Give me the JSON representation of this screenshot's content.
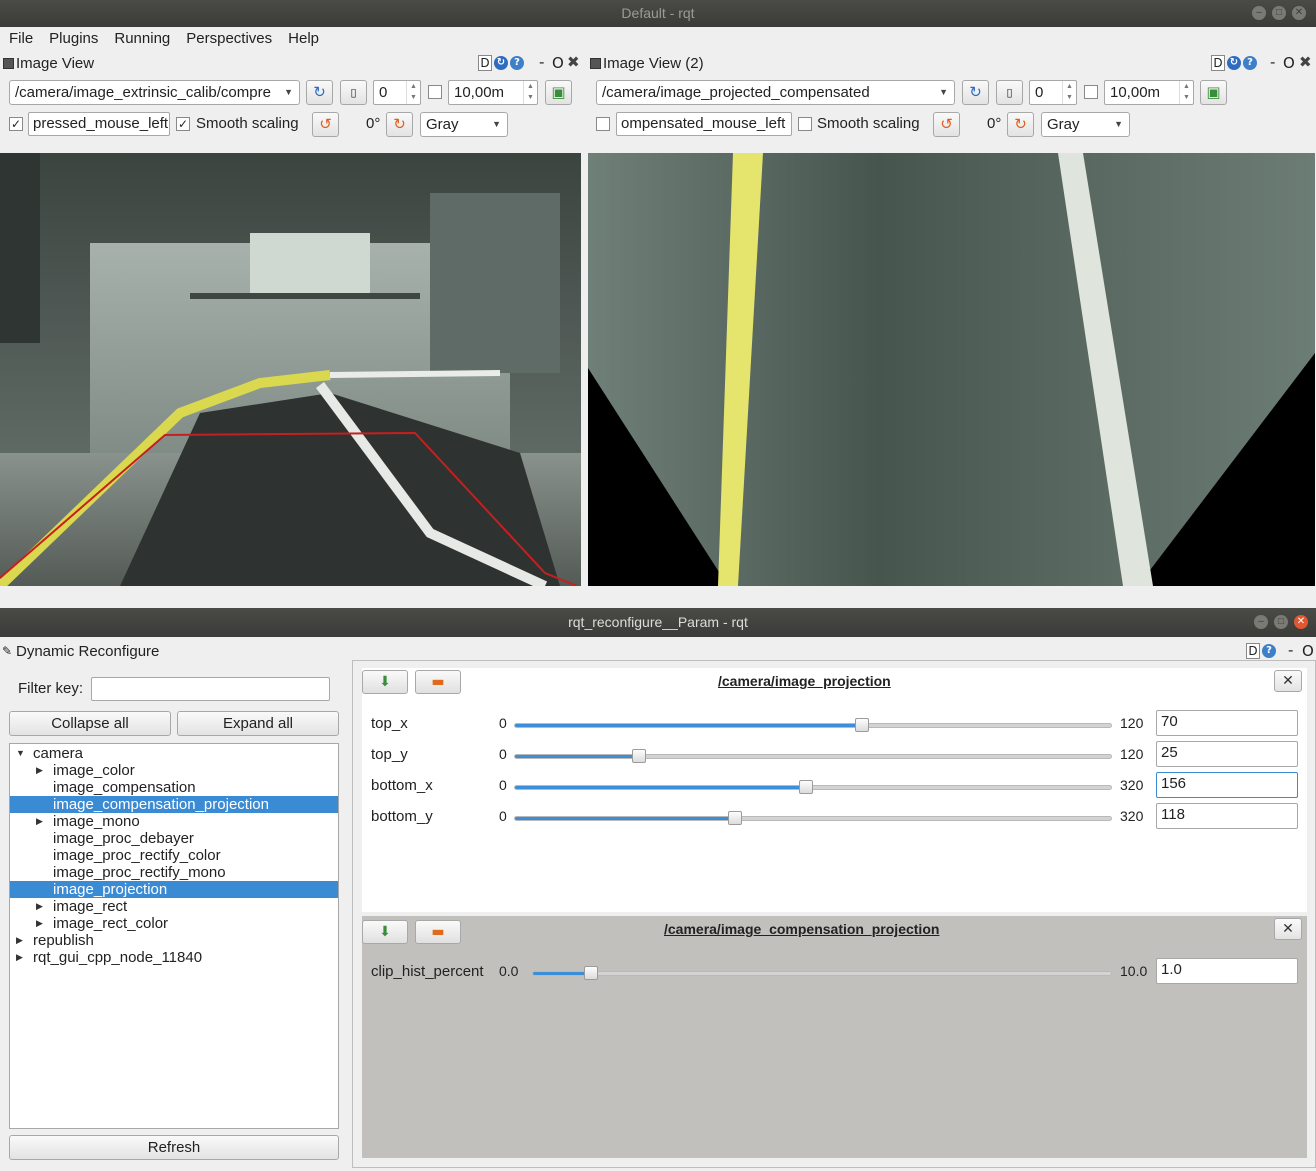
{
  "window_main": {
    "title": "Default - rqt"
  },
  "menu": [
    "File",
    "Plugins",
    "Running",
    "Perspectives",
    "Help"
  ],
  "image_view_1": {
    "title": "Image View",
    "topic": "/camera/image_extrinsic_calib/compre",
    "rotation_value": "0",
    "max_value": "10,00m",
    "mouse_topic": "pressed_mouse_left",
    "mouse_checked": true,
    "smooth_label": "Smooth scaling",
    "smooth_checked": true,
    "angle": "0°",
    "color_scheme": "Gray"
  },
  "image_view_2": {
    "title": "Image View (2)",
    "topic": "/camera/image_projected_compensated",
    "rotation_value": "0",
    "max_value": "10,00m",
    "mouse_topic": "ompensated_mouse_left",
    "mouse_checked": false,
    "smooth_label": "Smooth scaling",
    "smooth_checked": false,
    "angle": "0°",
    "color_scheme": "Gray"
  },
  "header_buttons": {
    "d": "D",
    "o": "O",
    "dash": "-"
  },
  "window_reconf": {
    "title": "rqt_reconfigure__Param - rqt"
  },
  "reconf": {
    "plugin_title": "Dynamic Reconfigure",
    "filter_label": "Filter key:",
    "filter_value": "",
    "collapse_label": "Collapse all",
    "expand_label": "Expand all",
    "refresh_label": "Refresh",
    "tree": [
      {
        "label": "camera",
        "depth": 0,
        "arrow": "down",
        "selected": false
      },
      {
        "label": "image_color",
        "depth": 1,
        "arrow": "right",
        "selected": false
      },
      {
        "label": "image_compensation",
        "depth": 1,
        "arrow": "",
        "selected": false
      },
      {
        "label": "image_compensation_projection",
        "depth": 1,
        "arrow": "",
        "selected": true
      },
      {
        "label": "image_mono",
        "depth": 1,
        "arrow": "right",
        "selected": false
      },
      {
        "label": "image_proc_debayer",
        "depth": 1,
        "arrow": "",
        "selected": false
      },
      {
        "label": "image_proc_rectify_color",
        "depth": 1,
        "arrow": "",
        "selected": false
      },
      {
        "label": "image_proc_rectify_mono",
        "depth": 1,
        "arrow": "",
        "selected": false
      },
      {
        "label": "image_projection",
        "depth": 1,
        "arrow": "",
        "selected": true
      },
      {
        "label": "image_rect",
        "depth": 1,
        "arrow": "right",
        "selected": false
      },
      {
        "label": "image_rect_color",
        "depth": 1,
        "arrow": "right",
        "selected": false
      },
      {
        "label": "republish",
        "depth": 0,
        "arrow": "right",
        "selected": false
      },
      {
        "label": "rqt_gui_cpp_node_11840",
        "depth": 0,
        "arrow": "right",
        "selected": false
      }
    ],
    "panel1": {
      "title": "/camera/image_projection",
      "params": [
        {
          "name": "top_x",
          "min": "0",
          "max": "120",
          "value": "70",
          "fraction": 0.583
        },
        {
          "name": "top_y",
          "min": "0",
          "max": "120",
          "value": "25",
          "fraction": 0.208
        },
        {
          "name": "bottom_x",
          "min": "0",
          "max": "320",
          "value": "156",
          "fraction": 0.4875
        },
        {
          "name": "bottom_y",
          "min": "0",
          "max": "320",
          "value": "118",
          "fraction": 0.369
        }
      ]
    },
    "panel2": {
      "title": "/camera/image_compensation_projection",
      "params": [
        {
          "name": "clip_hist_percent",
          "min": "0.0",
          "max": "10.0",
          "value": "1.0",
          "fraction": 0.1
        }
      ]
    }
  },
  "colors": {
    "selection": "#3a8bd4",
    "slider_fill": "#3d8ed8",
    "titlebar": "#3d3d3a",
    "close": "#e2572f"
  }
}
